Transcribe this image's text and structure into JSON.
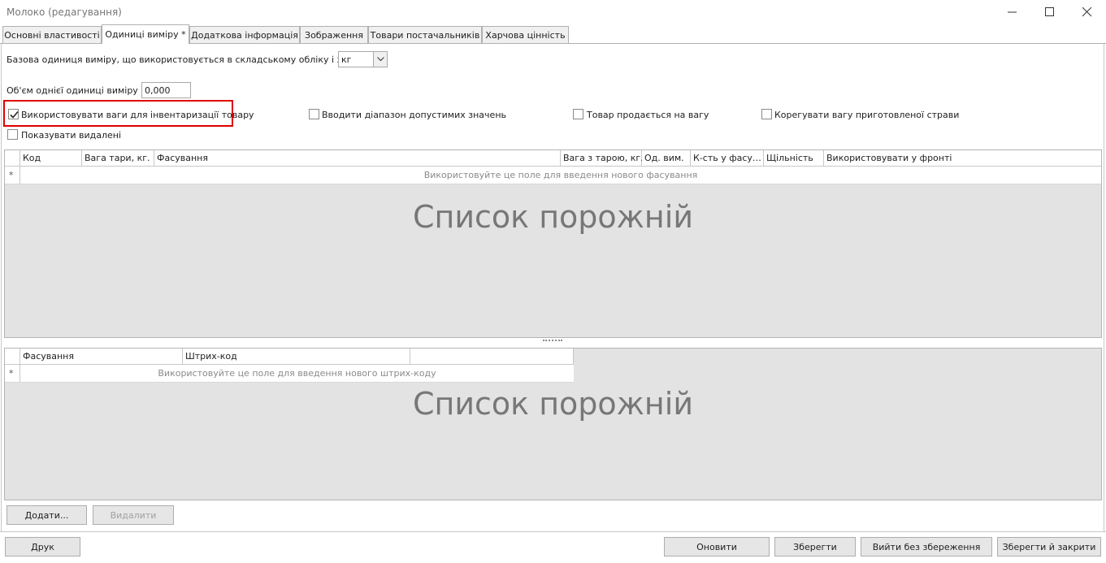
{
  "window": {
    "title": "Молоко (редагування)"
  },
  "tabs": [
    {
      "label": "Основні властивості"
    },
    {
      "label": "Одиниці виміру *"
    },
    {
      "label": "Додаткова інформація"
    },
    {
      "label": "Зображення"
    },
    {
      "label": "Товари постачальників"
    },
    {
      "label": "Харчова цінність"
    }
  ],
  "active_tab": "Одиниці виміру *",
  "units": {
    "base_label": "Базова одиниця виміру, що використовується в складському обліку і звітності:",
    "base_value": "кг",
    "volume_label": "Об'єм однієї одиниці виміру (л.).",
    "volume_value": "0,000"
  },
  "checkboxes": [
    {
      "label": "Використовувати ваги для інвентаризації товару",
      "checked": true,
      "highlighted": true
    },
    {
      "label": "Вводити діапазон допустимих значень",
      "checked": false
    },
    {
      "label": "Товар продається на вагу",
      "checked": false
    },
    {
      "label": "Корегувати вагу приготовленої страви",
      "checked": false
    },
    {
      "label": "Показувати видалені",
      "checked": false
    }
  ],
  "packaging_grid": {
    "columns": [
      "Код",
      "Вага тари, кг.",
      "Фасування",
      "Вага з тарою, кг.",
      "Од. вим.",
      "К-сть у фасу…",
      "Щільність",
      "Використовувати у фронті"
    ],
    "new_row_hint": "Використовуйте це поле для введення нового фасування",
    "empty_text": "Список порожній"
  },
  "barcode_grid": {
    "columns": [
      "Фасування",
      "Штрих-код",
      ""
    ],
    "new_row_hint": "Використовуйте це поле для введення нового штрих-коду",
    "empty_text": "Список порожній"
  },
  "row_marker": "*",
  "buttons": {
    "add": "Додати...",
    "delete": "Видалити",
    "print": "Друк",
    "refresh": "Оновити",
    "save": "Зберегти",
    "exit_no_save": "Вийти без збереження",
    "save_close": "Зберегти й закрити"
  },
  "colors": {
    "highlight": "#e00000",
    "grid_background": "#e3e3e3",
    "button_face": "#e6e6e6"
  },
  "icons": [
    "minimize-icon",
    "maximize-icon",
    "close-icon",
    "chevron-down-icon",
    "checkmark-icon"
  ]
}
